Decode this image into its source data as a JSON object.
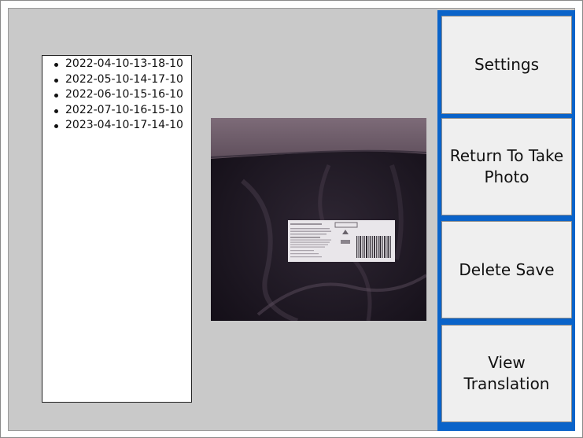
{
  "saves": {
    "items": [
      "2022-04-10-13-18-10",
      "2022-05-10-14-17-10",
      "2022-06-10-15-16-10",
      "2022-07-10-16-15-10",
      "2023-04-10-17-14-10"
    ]
  },
  "buttons": {
    "settings": "Settings",
    "return_to_take_photo": "Return To Take Photo",
    "delete_save": "Delete Save",
    "view_translation": "View Translation"
  },
  "colors": {
    "background": "#c9c9c9",
    "button_column": "#0a63c9",
    "button_face": "#efefef"
  }
}
